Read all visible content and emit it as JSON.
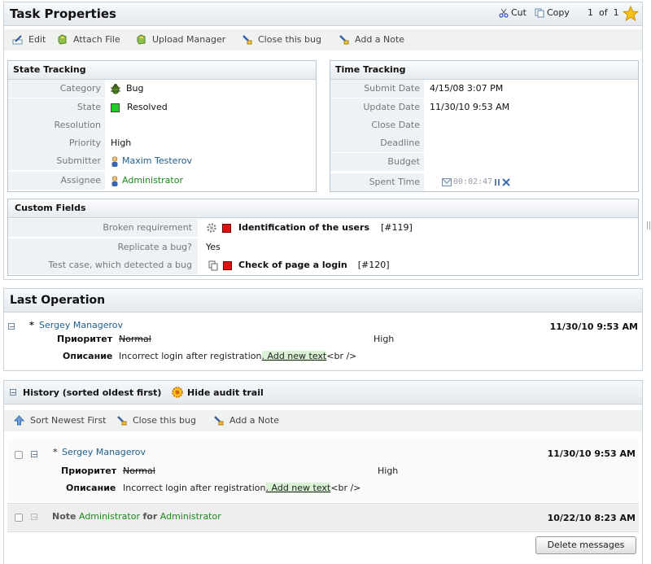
{
  "task": {
    "title": "Task Properties",
    "cut": "Cut",
    "copy": "Copy",
    "pager": "1  of  1",
    "toolbar": [
      "Edit",
      "Attach File",
      "Upload Manager",
      "Close this bug",
      "Add a Note"
    ]
  },
  "state_tracking": {
    "title": "State Tracking",
    "rows": [
      {
        "label": "Category",
        "value": "Bug"
      },
      {
        "label": "State",
        "value": "Resolved"
      },
      {
        "label": "Resolution",
        "value": ""
      },
      {
        "label": "Priority",
        "value": "High"
      },
      {
        "label": "Submitter",
        "value": "Maxim Testerov"
      },
      {
        "label": "Assignee",
        "value": "Administrator"
      }
    ]
  },
  "time_tracking": {
    "title": "Time Tracking",
    "rows": [
      {
        "label": "Submit Date",
        "value": "4/15/08 3:07 PM"
      },
      {
        "label": "Update Date",
        "value": "11/30/10 9:53 AM"
      },
      {
        "label": "Close Date",
        "value": ""
      },
      {
        "label": "Deadline",
        "value": ""
      },
      {
        "label": "Budget",
        "value": ""
      },
      {
        "label": "Spent Time",
        "value": "00:02:47"
      }
    ]
  },
  "custom_fields": {
    "title": "Custom Fields",
    "rows": [
      {
        "label": "Broken requirement",
        "value": "Identification of the users",
        "ref": "[#119]"
      },
      {
        "label": "Replicate a bug?",
        "value": "Yes",
        "ref": ""
      },
      {
        "label": "Test case, which detected a bug",
        "value": "Check of page a login",
        "ref": "[#120]"
      }
    ]
  },
  "last_operation": {
    "title": "Last Operation",
    "user": "Sergey Managerov",
    "date": "11/30/10 9:53 AM",
    "field1_label": "Приоритет",
    "field1_old": "Normal",
    "field1_new": "High",
    "field2_label": "Описание",
    "field2_text": "Incorrect login after registration",
    "field2_added": ". Add new text",
    "field2_tail": "<br />"
  },
  "history": {
    "title": "History (sorted oldest first)",
    "hide_audit": "Hide audit trail",
    "toolbar": [
      "Sort Newest First",
      "Close this bug",
      "Add a Note"
    ],
    "entry1": {
      "user": "Sergey Managerov",
      "date": "11/30/10 9:53 AM",
      "field1_label": "Приоритет",
      "field1_old": "Normal",
      "field1_new": "High",
      "field2_label": "Описание",
      "field2_text": "Incorrect login after registration",
      "field2_added": ". Add new text",
      "field2_tail": "<br />"
    },
    "entry2": {
      "note_word": "Note",
      "from": "Administrator",
      "for_word": "for",
      "to": "Administrator",
      "date": "10/22/10 8:23 AM"
    },
    "delete_button": "Delete messages"
  },
  "colors": {
    "resolved": "#22cc22",
    "red_marker": "#dd1111",
    "link": "#1f5e8c",
    "green_link": "#1a8a1a"
  }
}
